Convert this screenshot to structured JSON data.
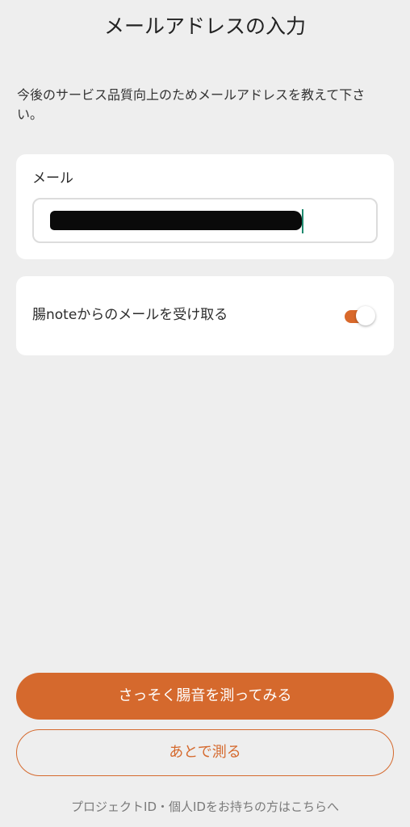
{
  "header": {
    "title": "メールアドレスの入力"
  },
  "description": "今後のサービス品質向上のためメールアドレスを教えて下さい。",
  "email_card": {
    "label": "メール",
    "value": "",
    "redacted": true
  },
  "optin": {
    "label": "腸noteからのメールを受け取る",
    "enabled": true
  },
  "actions": {
    "primary_label": "さっそく腸音を測ってみる",
    "secondary_label": "あとで測る"
  },
  "footer": {
    "link_label": "プロジェクトID・個人IDをお持ちの方はこちらへ"
  },
  "colors": {
    "accent": "#d5692d",
    "background": "#eeeeee",
    "card": "#ffffff",
    "caret": "#1f8a6f"
  }
}
